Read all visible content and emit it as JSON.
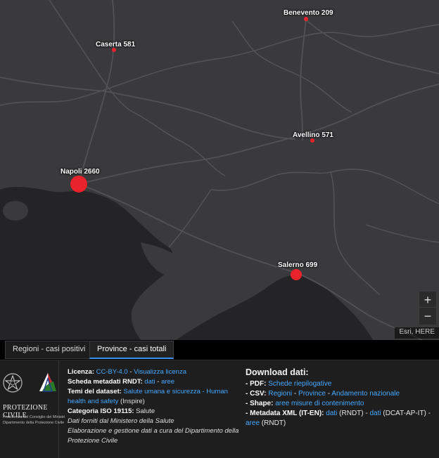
{
  "map": {
    "cities": [
      {
        "name": "Caserta",
        "cases": "581"
      },
      {
        "name": "Benevento",
        "cases": "209"
      },
      {
        "name": "Avellino",
        "cases": "571"
      },
      {
        "name": "Napoli",
        "cases": "2660"
      },
      {
        "name": "Salerno",
        "cases": "699"
      }
    ],
    "zoom_in": "+",
    "zoom_out": "−",
    "attribution": "Esri, HERE",
    "colors": {
      "land": "#3a3a3c",
      "sea": "#242426",
      "marker": "#e8232b"
    }
  },
  "tabs": [
    {
      "label": "Regioni - casi positivi"
    },
    {
      "label": "Province - casi totali"
    }
  ],
  "logo": {
    "title": "PROTEZIONE CIVILE",
    "sub1": "Presidenza del Consiglio dei Ministri",
    "sub2": "Dipartimento della Protezione Civile"
  },
  "meta": {
    "license_label": "Licenza:",
    "license_link": "CC-BY-4.0",
    "license_sep": " - ",
    "license_view": "Visualizza licenza",
    "rndt_label": "Scheda metadati RNDT:",
    "rndt_dati": "dati",
    "rndt_sep": " - ",
    "rndt_aree": "aree",
    "themes_label": "Temi del dataset:",
    "themes_link": "Salute umana e sicurezza - Human health and safety",
    "themes_tail": " (Inspire)",
    "iso_label": "Categoria ISO 19115:",
    "iso_value": " Salute",
    "source": "Dati forniti dal Ministero della Salute",
    "elab": "Elaborazione e gestione dati a cura del Dipartimento della Protezione Civile"
  },
  "download": {
    "title": "Download dati:",
    "pdf_label": "- PDF:",
    "pdf_link": "Schede riepilogative",
    "csv_label": "- CSV:",
    "csv_regioni": "Regioni",
    "csv_sep1": " - ",
    "csv_province": "Province",
    "csv_sep2": " - ",
    "csv_andamento": "Andamento nazionale",
    "shape_label": "- Shape:",
    "shape_link": "aree misure di contenimento",
    "xml_label": "- Metadata XML (IT-EN):",
    "xml_dati1": "dati",
    "xml_rndt1": " (RNDT) - ",
    "xml_dati2": "dati",
    "xml_dcat": " (DCAT-AP-IT) -",
    "xml_aree": "aree",
    "xml_rndt2": " (RNDT)"
  }
}
